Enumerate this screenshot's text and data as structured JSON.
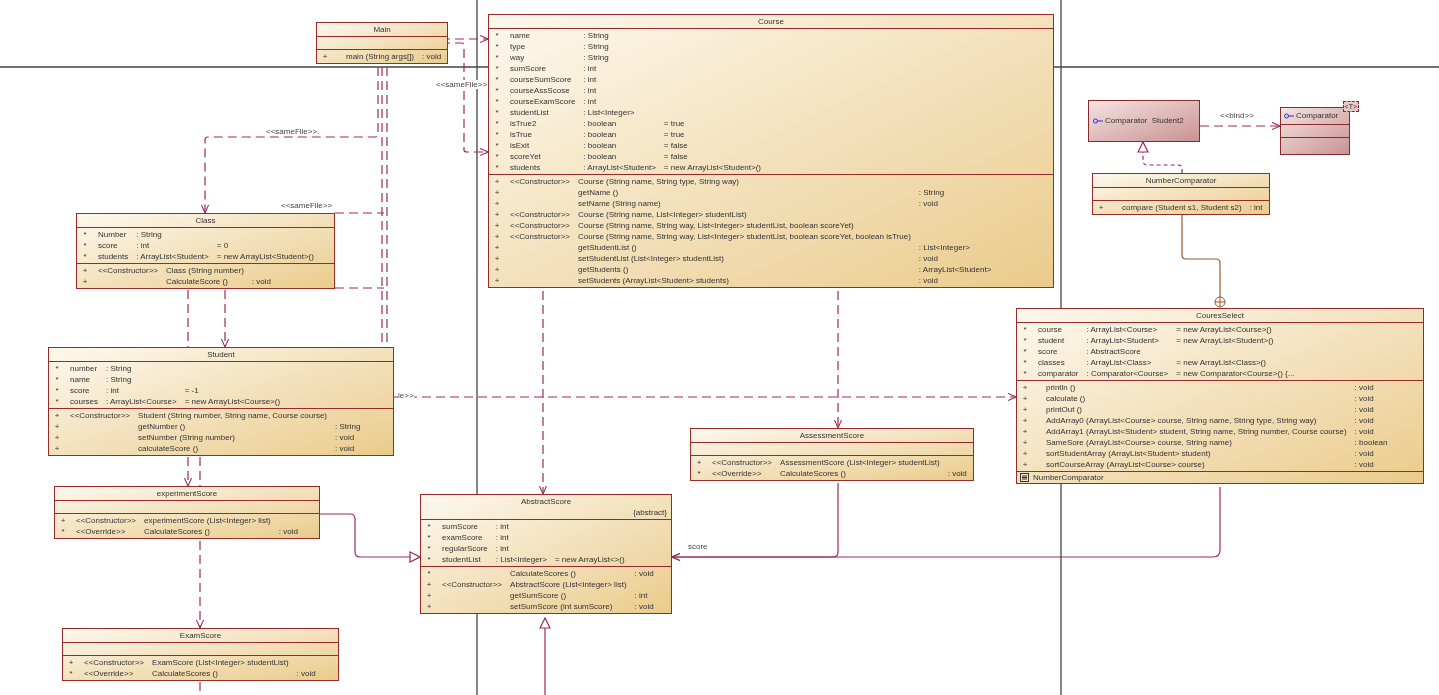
{
  "classes": [
    {
      "kind": "class",
      "name": "Main",
      "operations": [
        {
          "visibility": "+",
          "signature": "main (String args[])",
          "returns": ": void"
        }
      ]
    },
    {
      "kind": "class",
      "name": "Class",
      "attributes": [
        {
          "visibility": "*",
          "name": "Number",
          "type": ": String"
        },
        {
          "visibility": "*",
          "name": "score",
          "type": ": int",
          "default": "= 0"
        },
        {
          "visibility": "*",
          "name": "students",
          "type": ": ArrayList<Student>",
          "default": "= new ArrayList<Student>()"
        }
      ],
      "operations": [
        {
          "visibility": "+",
          "stereotype": "<<Constructor>>",
          "signature": "Class (String number)"
        },
        {
          "visibility": "+",
          "signature": "CalculateScore ()",
          "returns": ": void"
        }
      ]
    },
    {
      "kind": "class",
      "name": "Student",
      "attributes": [
        {
          "visibility": "*",
          "name": "number",
          "type": ": String"
        },
        {
          "visibility": "*",
          "name": "name",
          "type": ": String"
        },
        {
          "visibility": "*",
          "name": "score",
          "type": ": int",
          "default": "= -1"
        },
        {
          "visibility": "*",
          "name": "courses",
          "type": ": ArrayList<Course>",
          "default": "= new ArrayList<Course>()"
        }
      ],
      "operations": [
        {
          "visibility": "+",
          "stereotype": "<<Constructor>>",
          "signature": "Student (String number, String name, Course course)"
        },
        {
          "visibility": "+",
          "signature": "getNumber ()",
          "returns": ": String"
        },
        {
          "visibility": "+",
          "signature": "setNumber (String number)",
          "returns": ": void"
        },
        {
          "visibility": "+",
          "signature": "calculateScore ()",
          "returns": ": void"
        }
      ]
    },
    {
      "kind": "class",
      "name": "experimentScore",
      "operations": [
        {
          "visibility": "+",
          "stereotype": "<<Constructor>>",
          "signature": "experimentScore (List<Integer> list)"
        },
        {
          "visibility": "*",
          "stereotype": "<<Override>>",
          "signature": "CalculateScores ()",
          "returns": ": void"
        }
      ]
    },
    {
      "kind": "class",
      "name": "ExamScore",
      "operations": [
        {
          "visibility": "+",
          "stereotype": "<<Constructor>>",
          "signature": "ExamScore (List<Integer> studentList)"
        },
        {
          "visibility": "*",
          "stereotype": "<<Override>>",
          "signature": "CalculateScores ()",
          "returns": ": void"
        }
      ]
    },
    {
      "kind": "class",
      "name": "Course",
      "attributes": [
        {
          "visibility": "*",
          "name": "name",
          "type": ": String"
        },
        {
          "visibility": "*",
          "name": "type",
          "type": ": String"
        },
        {
          "visibility": "*",
          "name": "way",
          "type": ": String"
        },
        {
          "visibility": "*",
          "name": "sumScore",
          "type": ": int"
        },
        {
          "visibility": "*",
          "name": "courseSumScore",
          "type": ": int"
        },
        {
          "visibility": "*",
          "name": "courseAssScose",
          "type": ": int"
        },
        {
          "visibility": "*",
          "name": "courseExamScore",
          "type": ": int"
        },
        {
          "visibility": "*",
          "name": "studentList",
          "type": ": List<Integer>"
        },
        {
          "visibility": "*",
          "name": "isTrue2",
          "type": ": boolean",
          "default": "= true"
        },
        {
          "visibility": "*",
          "name": "isTrue",
          "type": ": boolean",
          "default": "= true"
        },
        {
          "visibility": "*",
          "name": "isExit",
          "type": ": boolean",
          "default": "= false"
        },
        {
          "visibility": "*",
          "name": "scoreYet",
          "type": ": boolean",
          "default": "= false"
        },
        {
          "visibility": "*",
          "name": "students",
          "type": ": ArrayList<Student>",
          "default": "= new ArrayList<Student>()"
        }
      ],
      "operations": [
        {
          "visibility": "+",
          "stereotype": "<<Constructor>>",
          "signature": "Course (String name, String type, String way)"
        },
        {
          "visibility": "+",
          "signature": "getName ()",
          "returns": ": String"
        },
        {
          "visibility": "+",
          "signature": "setName (String name)",
          "returns": ": void"
        },
        {
          "visibility": "+",
          "stereotype": "<<Constructor>>",
          "signature": "Course (String name, List<Integer> studentList)"
        },
        {
          "visibility": "+",
          "stereotype": "<<Constructor>>",
          "signature": "Course (String name, String way, List<Integer> studentList, boolean scoreYet)"
        },
        {
          "visibility": "+",
          "stereotype": "<<Constructor>>",
          "signature": "Course (String name, String way, List<Integer> studentList, boolean scoreYet, boolean isTrue)"
        },
        {
          "visibility": "+",
          "signature": "getStudentList ()",
          "returns": ": List<Integer>"
        },
        {
          "visibility": "+",
          "signature": "setStudentList (List<Integer> studentList)",
          "returns": ": void"
        },
        {
          "visibility": "+",
          "signature": "getStudents ()",
          "returns": ": ArrayList<Student>"
        },
        {
          "visibility": "+",
          "signature": "setStudents (ArrayList<Student> students)",
          "returns": ": void"
        }
      ]
    },
    {
      "kind": "class",
      "name": "AbstractScore",
      "modifier": "{abstract}",
      "attributes": [
        {
          "visibility": "*",
          "name": "sumScore",
          "type": ": int"
        },
        {
          "visibility": "*",
          "name": "examScore",
          "type": ": int"
        },
        {
          "visibility": "*",
          "name": "regularScore",
          "type": ": int"
        },
        {
          "visibility": "*",
          "name": "studentList",
          "type": ": List<Integer>",
          "default": "= new ArrayList<>()"
        }
      ],
      "operations": [
        {
          "visibility": "*",
          "signature": "CalculateScores ()",
          "returns": ": void"
        },
        {
          "visibility": "+",
          "stereotype": "<<Constructor>>",
          "signature": "AbstractScore (List<Integer> list)"
        },
        {
          "visibility": "+",
          "signature": "getSumScore ()",
          "returns": ": int"
        },
        {
          "visibility": "+",
          "signature": "setSumScore (int sumScore)",
          "returns": ": void"
        }
      ]
    },
    {
      "kind": "class",
      "name": "AssessmentScore",
      "operations": [
        {
          "visibility": "+",
          "stereotype": "<<Constructor>>",
          "signature": "AssessmentScore (List<Integer> studentList)"
        },
        {
          "visibility": "*",
          "stereotype": "<<Override>>",
          "signature": "CalculateScores ()",
          "returns": ": void"
        }
      ]
    },
    {
      "kind": "interface",
      "name": "Comparator  Student2"
    },
    {
      "kind": "template_interface",
      "name": "Comparator",
      "template": "<T>"
    },
    {
      "kind": "class",
      "name": "NumberComparator",
      "operations": [
        {
          "visibility": "+",
          "signature": "compare (Student s1, Student s2)",
          "returns": ": int"
        }
      ]
    },
    {
      "kind": "class",
      "name": "CouresSelect",
      "attributes": [
        {
          "visibility": "*",
          "name": "course",
          "type": ": ArrayList<Course>",
          "default": "= new ArrayList<Course>()"
        },
        {
          "visibility": "*",
          "name": "student",
          "type": ": ArrayList<Student>",
          "default": "= new ArrayList<Student>()"
        },
        {
          "visibility": "*",
          "name": "score",
          "type": ": AbstractScore"
        },
        {
          "visibility": "*",
          "name": "classes",
          "type": ": ArrayList<Class>",
          "default": "= new ArrayList<Class>()"
        },
        {
          "visibility": "*",
          "name": "comparator",
          "type": ": Comparator<Course>",
          "default": "= new Comparator<Course>() {..."
        }
      ],
      "operations": [
        {
          "visibility": "+",
          "signature": "println ()",
          "returns": ": void"
        },
        {
          "visibility": "+",
          "signature": "calculate ()",
          "returns": ": void"
        },
        {
          "visibility": "+",
          "signature": "printOut ()",
          "returns": ": void"
        },
        {
          "visibility": "+",
          "signature": "AddArray0 (ArrayList<Course> course, String name, String type, String way)",
          "returns": ": void"
        },
        {
          "visibility": "+",
          "signature": "AddArray1 (ArrayList<Student> student, String name, String number, Course course)",
          "returns": ": void"
        },
        {
          "visibility": "+",
          "signature": "SameSore (ArrayList<Course> course, String name)",
          "returns": ": boolean"
        },
        {
          "visibility": "+",
          "signature": "sortStudentArray (ArrayList<Student> student)",
          "returns": ": void"
        },
        {
          "visibility": "+",
          "signature": "sortCourseArray (ArrayList<Course> course)",
          "returns": ": void"
        }
      ],
      "nested": [
        "NumberComparator"
      ]
    }
  ],
  "connectors": [
    {
      "kind": "dependency"
    },
    {
      "kind": "dependency",
      "label": "<<sameFile>>"
    },
    {
      "kind": "dependency",
      "label": "<<sameFile>>."
    },
    {
      "kind": "line"
    },
    {
      "kind": "line"
    },
    {
      "kind": "line",
      "label": "<<sameFile>>"
    },
    {
      "kind": "line"
    },
    {
      "kind": "dependency"
    },
    {
      "kind": "line"
    },
    {
      "kind": "dependency"
    },
    {
      "kind": "line"
    },
    {
      "kind": "dependency"
    },
    {
      "kind": "line"
    },
    {
      "kind": "generalization"
    },
    {
      "kind": "dependency",
      "label": "le>>"
    },
    {
      "kind": "dependency"
    },
    {
      "kind": "dependency"
    },
    {
      "kind": "association"
    },
    {
      "kind": "association",
      "label": "score"
    },
    {
      "kind": "generalization"
    },
    {
      "kind": "dependency",
      "label": "<<bind>>"
    },
    {
      "kind": "realization"
    },
    {
      "kind": "nesting"
    }
  ]
}
